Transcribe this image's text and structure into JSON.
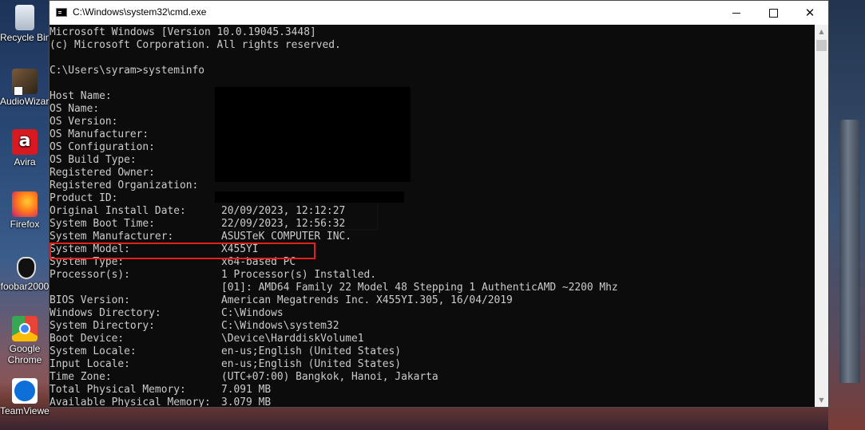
{
  "desktop": {
    "icons": [
      {
        "label": "Recycle Bin",
        "icon": "recycle-bin-icon"
      },
      {
        "label": "AudioWizard",
        "icon": "audiowizard-icon"
      },
      {
        "label": "Avira",
        "icon": "avira-icon"
      },
      {
        "label": "Firefox",
        "icon": "firefox-icon"
      },
      {
        "label": "foobar2000",
        "icon": "foobar2000-icon"
      },
      {
        "label": "Google Chrome",
        "icon": "chrome-icon"
      },
      {
        "label": "TeamViewer",
        "icon": "teamviewer-icon"
      }
    ]
  },
  "window": {
    "title": "C:\\Windows\\system32\\cmd.exe",
    "buttons": {
      "minimize": "",
      "maximize": "",
      "close": "✕"
    }
  },
  "console": {
    "header": [
      "Microsoft Windows [Version 10.0.19045.3448]",
      "(c) Microsoft Corporation. All rights reserved."
    ],
    "command": "C:\\Users\\syram>systeminfo",
    "rows": [
      {
        "label": "Host Name:",
        "value": ""
      },
      {
        "label": "OS Name:",
        "value": ""
      },
      {
        "label": "OS Version:",
        "value": ""
      },
      {
        "label": "OS Manufacturer:",
        "value": ""
      },
      {
        "label": "OS Configuration:",
        "value": ""
      },
      {
        "label": "OS Build Type:",
        "value": ""
      },
      {
        "label": "Registered Owner:",
        "value": ""
      },
      {
        "label": "Registered Organization:",
        "value": ""
      },
      {
        "label": "Product ID:",
        "value": ""
      },
      {
        "label": "Original Install Date:",
        "value": "20/09/2023, 12:12:27"
      },
      {
        "label": "System Boot Time:",
        "value": "22/09/2023, 12:56:32"
      },
      {
        "label": "System Manufacturer:",
        "value": "ASUSTeK COMPUTER INC."
      },
      {
        "label": "System Model:",
        "value": "X455YI"
      },
      {
        "label": "System Type:",
        "value": "x64-based PC"
      },
      {
        "label": "Processor(s):",
        "value": "1 Processor(s) Installed."
      },
      {
        "label": "",
        "value": "[01]: AMD64 Family 22 Model 48 Stepping 1 AuthenticAMD ~2200 Mhz"
      },
      {
        "label": "BIOS Version:",
        "value": "American Megatrends Inc. X455YI.305, 16/04/2019"
      },
      {
        "label": "Windows Directory:",
        "value": "C:\\Windows"
      },
      {
        "label": "System Directory:",
        "value": "C:\\Windows\\system32"
      },
      {
        "label": "Boot Device:",
        "value": "\\Device\\HarddiskVolume1"
      },
      {
        "label": "System Locale:",
        "value": "en-us;English (United States)"
      },
      {
        "label": "Input Locale:",
        "value": "en-us;English (United States)"
      },
      {
        "label": "Time Zone:",
        "value": "(UTC+07:00) Bangkok, Hanoi, Jakarta"
      },
      {
        "label": "Total Physical Memory:",
        "value": "7.091 MB"
      },
      {
        "label": "Available Physical Memory:",
        "value": "3.079 MB"
      }
    ]
  },
  "colors": {
    "console_bg": "#0c0c0c",
    "console_text": "#cccccc",
    "highlight": "#e0211d"
  }
}
